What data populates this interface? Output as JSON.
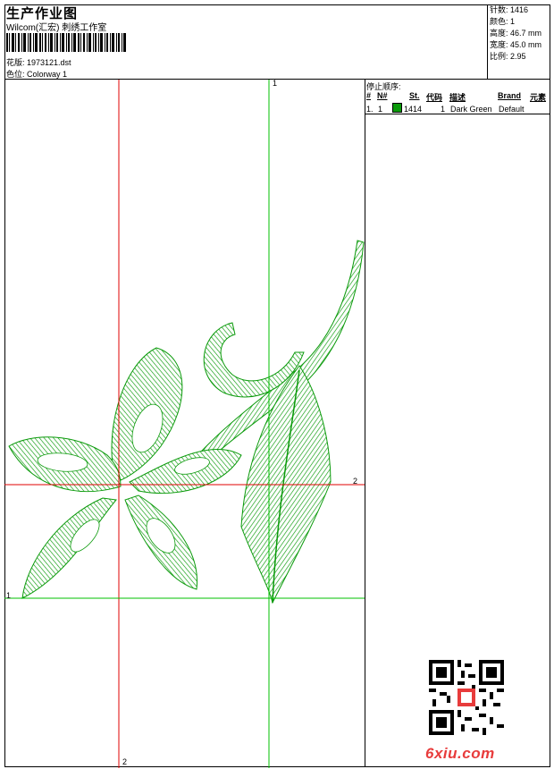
{
  "header": {
    "title": "生产作业图",
    "subtitle": "Wilcom(汇宏) 刺绣工作室",
    "design_label": "花版: 1973121.dst",
    "colorway_label": "色位: Colorway 1"
  },
  "stats": {
    "stitches": "针数: 1416",
    "colors": "颜色: 1",
    "height": "高度: 46.7 mm",
    "width": "宽度: 45.0 mm",
    "scale": "比例: 2.95"
  },
  "canvas": {
    "axis_labels": {
      "v_green_top": "1",
      "h_green_left": "1",
      "h_red_right": "2",
      "v_red_bottom": "2"
    },
    "colors": {
      "stitch": "#0a9a0a",
      "axis_red": "#e00000",
      "axis_green": "#00c000"
    }
  },
  "stop_sequence": {
    "title": "停止顺序:",
    "headers": [
      "#",
      "N#",
      "St.",
      "代码",
      "描述",
      "Brand",
      "元素"
    ],
    "rows": [
      {
        "index": "1.",
        "needle": "1",
        "stitches": "1414",
        "code": "1",
        "description": "Dark Green",
        "brand": "Default",
        "color": "#0a9a0a"
      }
    ]
  },
  "footer": {
    "watermark": "6xiu.com",
    "qr_icon": "qr-code-icon"
  }
}
